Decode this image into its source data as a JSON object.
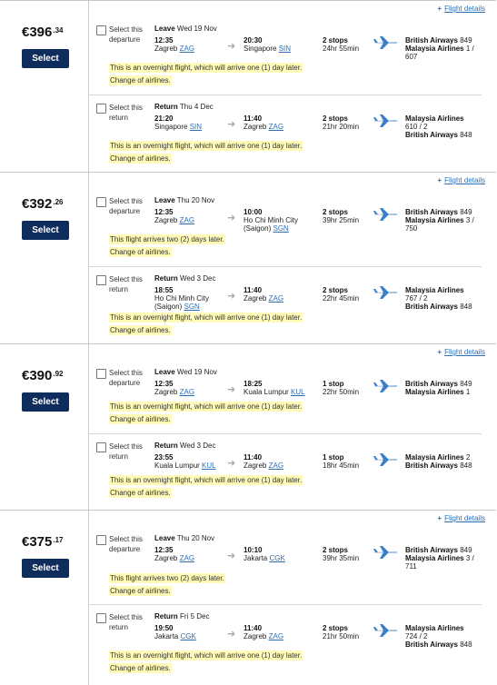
{
  "details_link": "Flight details",
  "select_button": "Select",
  "offers": [
    {
      "price_main": "€396",
      "price_cents": ".34",
      "outbound": {
        "select_label": "Select this departure",
        "leg_label": "Leave",
        "date": "Wed 19 Nov",
        "dep_time": "12:35",
        "dep_city": "Zagreb",
        "dep_code": "ZAG",
        "arr_time": "20:30",
        "arr_city": "Singapore",
        "arr_code": "SIN",
        "stops": "2 stops",
        "duration": "24hr 55min",
        "airline1": "British Airways",
        "flight1": "849",
        "airline2": "Malaysia Airlines",
        "flight2": "1 / 607",
        "notes": [
          "This is an overnight flight, which will arrive one (1) day later.",
          "Change of airlines."
        ]
      },
      "return": {
        "select_label": "Select this return",
        "leg_label": "Return",
        "date": "Thu 4 Dec",
        "dep_time": "21:20",
        "dep_city": "Singapore",
        "dep_code": "SIN",
        "arr_time": "11:40",
        "arr_city": "Zagreb",
        "arr_code": "ZAG",
        "stops": "2 stops",
        "duration": "21hr 20min",
        "airline1": "Malaysia Airlines",
        "flight1": "610 / 2",
        "airline2": "British Airways",
        "flight2": "848",
        "notes": [
          "This is an overnight flight, which will arrive one (1) day later.",
          "Change of airlines."
        ]
      }
    },
    {
      "price_main": "€392",
      "price_cents": ".26",
      "outbound": {
        "select_label": "Select this departure",
        "leg_label": "Leave",
        "date": "Thu 20 Nov",
        "dep_time": "12:35",
        "dep_city": "Zagreb",
        "dep_code": "ZAG",
        "arr_time": "10:00",
        "arr_city": "Ho Chi Minh City (Saigon)",
        "arr_code": "SGN",
        "stops": "2 stops",
        "duration": "39hr 25min",
        "airline1": "British Airways",
        "flight1": "849",
        "airline2": "Malaysia Airlines",
        "flight2": "3 / 750",
        "notes": [
          "This flight arrives two (2) days later.",
          "Change of airlines."
        ]
      },
      "return": {
        "select_label": "Select this return",
        "leg_label": "Return",
        "date": "Wed 3 Dec",
        "dep_time": "18:55",
        "dep_city": "Ho Chi Minh City (Saigon)",
        "dep_code": "SGN",
        "arr_time": "11:40",
        "arr_city": "Zagreb",
        "arr_code": "ZAG",
        "stops": "2 stops",
        "duration": "22hr 45min",
        "airline1": "Malaysia Airlines",
        "flight1": "767 / 2",
        "airline2": "British Airways",
        "flight2": "848",
        "notes": [
          "This is an overnight flight, which will arrive one (1) day later.",
          "Change of airlines."
        ]
      }
    },
    {
      "price_main": "€390",
      "price_cents": ".92",
      "outbound": {
        "select_label": "Select this departure",
        "leg_label": "Leave",
        "date": "Wed 19 Nov",
        "dep_time": "12:35",
        "dep_city": "Zagreb",
        "dep_code": "ZAG",
        "arr_time": "18:25",
        "arr_city": "Kuala Lumpur",
        "arr_code": "KUL",
        "stops": "1 stop",
        "duration": "22hr 50min",
        "airline1": "British Airways",
        "flight1": "849",
        "airline2": "Malaysia Airlines",
        "flight2": "1",
        "notes": [
          "This is an overnight flight, which will arrive one (1) day later.",
          "Change of airlines."
        ]
      },
      "return": {
        "select_label": "Select this return",
        "leg_label": "Return",
        "date": "Wed 3 Dec",
        "dep_time": "23:55",
        "dep_city": "Kuala Lumpur",
        "dep_code": "KUL",
        "arr_time": "11:40",
        "arr_city": "Zagreb",
        "arr_code": "ZAG",
        "stops": "1 stop",
        "duration": "18hr 45min",
        "airline1": "Malaysia Airlines",
        "flight1": "2",
        "airline2": "British Airways",
        "flight2": "848",
        "notes": [
          "This is an overnight flight, which will arrive one (1) day later.",
          "Change of airlines."
        ]
      }
    },
    {
      "price_main": "€375",
      "price_cents": ".17",
      "outbound": {
        "select_label": "Select this departure",
        "leg_label": "Leave",
        "date": "Thu 20 Nov",
        "dep_time": "12:35",
        "dep_city": "Zagreb",
        "dep_code": "ZAG",
        "arr_time": "10:10",
        "arr_city": "Jakarta",
        "arr_code": "CGK",
        "stops": "2 stops",
        "duration": "39hr 35min",
        "airline1": "British Airways",
        "flight1": "849",
        "airline2": "Malaysia Airlines",
        "flight2": "3 / 711",
        "notes": [
          "This flight arrives two (2) days later.",
          "Change of airlines."
        ]
      },
      "return": {
        "select_label": "Select this return",
        "leg_label": "Return",
        "date": "Fri 5 Dec",
        "dep_time": "19:50",
        "dep_city": "Jakarta",
        "dep_code": "CGK",
        "arr_time": "11:40",
        "arr_city": "Zagreb",
        "arr_code": "ZAG",
        "stops": "2 stops",
        "duration": "21hr 50min",
        "airline1": "Malaysia Airlines",
        "flight1": "724 / 2",
        "airline2": "British Airways",
        "flight2": "848",
        "notes": [
          "This is an overnight flight, which will arrive one (1) day later.",
          "Change of airlines."
        ]
      }
    }
  ]
}
